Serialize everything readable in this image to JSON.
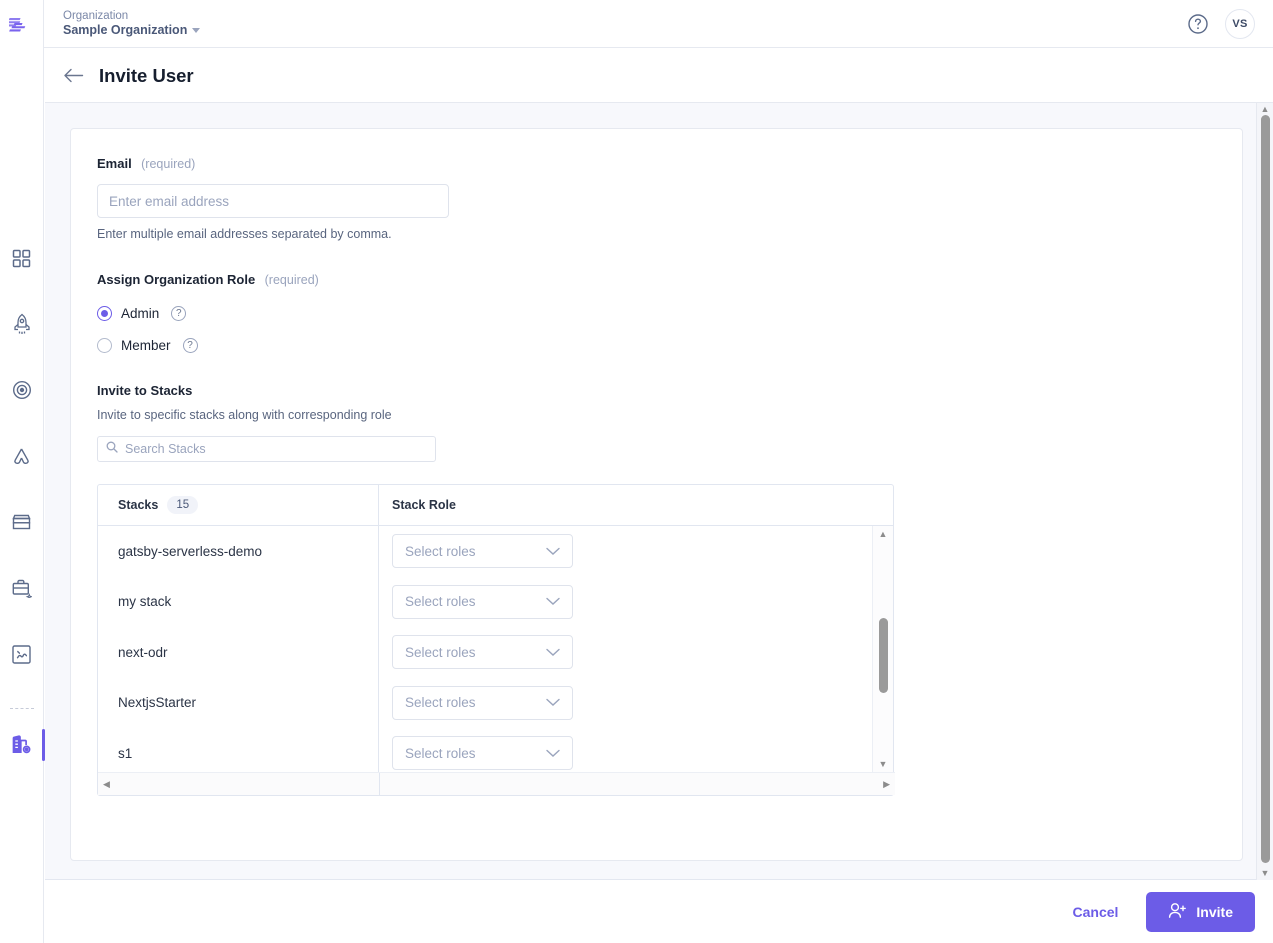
{
  "brand": {
    "logo_icon": "serverless-logo",
    "accent": "#6c5ce7"
  },
  "topbar": {
    "org_label": "Organization",
    "org_name": "Sample Organization",
    "help_icon": "question-circle-icon",
    "avatar_initials": "VS"
  },
  "page": {
    "back_icon": "arrow-left-icon",
    "title": "Invite User"
  },
  "sidebar": {
    "items": [
      {
        "icon": "grid-dashboard-icon",
        "active": false
      },
      {
        "icon": "rocket-icon",
        "active": false
      },
      {
        "icon": "target-icon",
        "active": false
      },
      {
        "icon": "apps-icon",
        "active": false
      },
      {
        "icon": "store-icon",
        "active": false
      },
      {
        "icon": "briefcase-icon",
        "active": false
      },
      {
        "icon": "puzzle-icon",
        "active": false
      },
      {
        "icon": "organization-settings-icon",
        "active": true
      }
    ]
  },
  "form": {
    "email": {
      "label": "Email",
      "required_text": "(required)",
      "placeholder": "Enter email address",
      "value": "",
      "hint": "Enter multiple email addresses separated by comma."
    },
    "org_role": {
      "label": "Assign Organization Role",
      "required_text": "(required)",
      "options": [
        {
          "label": "Admin",
          "selected": true,
          "help_icon": "question-circle-icon"
        },
        {
          "label": "Member",
          "selected": false,
          "help_icon": "question-circle-icon"
        }
      ]
    },
    "stacks": {
      "label": "Invite to Stacks",
      "description": "Invite to specific stacks along with corresponding role",
      "search_placeholder": "Search Stacks",
      "search_value": "",
      "search_icon": "search-icon",
      "table": {
        "col_stacks": "Stacks",
        "count": "15",
        "col_role": "Stack Role",
        "role_placeholder": "Select roles",
        "chevron_icon": "chevron-down-icon",
        "rows": [
          {
            "name": "gatsby-serverless-demo",
            "role": "Select roles"
          },
          {
            "name": "my stack",
            "role": "Select roles"
          },
          {
            "name": "next-odr",
            "role": "Select roles"
          },
          {
            "name": "NextjsStarter",
            "role": "Select roles"
          },
          {
            "name": "s1",
            "role": "Select roles"
          }
        ]
      }
    }
  },
  "footer": {
    "cancel_label": "Cancel",
    "invite_label": "Invite",
    "invite_icon": "user-plus-icon"
  }
}
